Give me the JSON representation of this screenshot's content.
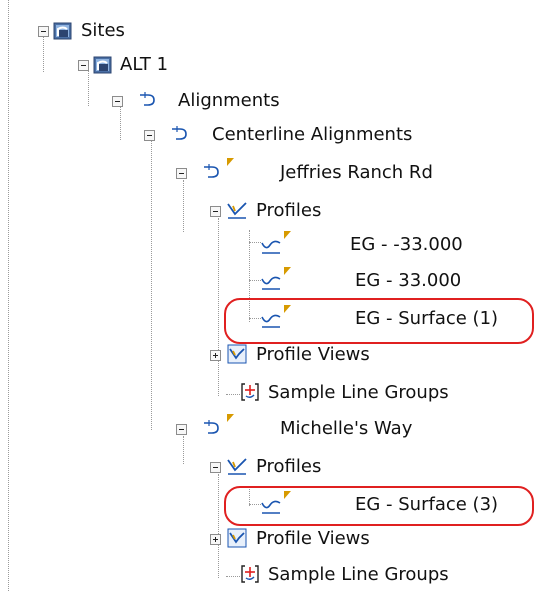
{
  "tree": {
    "sites_label": "Sites",
    "alt1_label": "ALT 1",
    "alignments_label": "Alignments",
    "centerline_label": "Centerline Alignments",
    "alignment1": {
      "name": "Jeffries Ranch Rd",
      "profiles_label": "Profiles",
      "profiles": [
        "EG - -33.000",
        "EG - 33.000",
        "EG - Surface (1)"
      ],
      "profile_views_label": "Profile Views",
      "sample_line_groups_label": "Sample Line Groups"
    },
    "alignment2": {
      "name": "Michelle's Way",
      "profiles_label": "Profiles",
      "profiles": [
        "EG - Surface (3)"
      ],
      "profile_views_label": "Profile Views",
      "sample_line_groups_label": "Sample Line Groups"
    }
  },
  "highlight_color": "#e02020",
  "highlighted_items": [
    "EG - Surface (1)",
    "EG - Surface (3)"
  ]
}
